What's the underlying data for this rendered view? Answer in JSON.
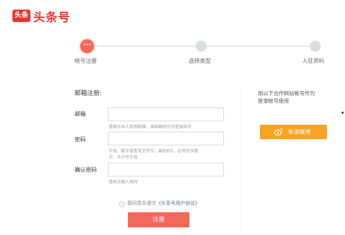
{
  "header": {
    "logo_mark": "头条",
    "logo_text": "头条号"
  },
  "steps": [
    {
      "label": "帐号注册",
      "state": "active",
      "icon": "ellipsis-icon",
      "glyph": "···"
    },
    {
      "label": "选择类型",
      "state": "pending"
    },
    {
      "label": "入驻资料",
      "state": "pending"
    }
  ],
  "form": {
    "title": "邮箱注册:",
    "email": {
      "label": "邮箱",
      "value": "",
      "hint": "请填写本人常用邮箱，该邮箱将作为登录帐号"
    },
    "password": {
      "label": "密码",
      "value": "",
      "hint_line1": "字母、数字或者英文符号，最短8位，必须包含数",
      "hint_line2": "字、大小写字母"
    },
    "confirm": {
      "label": "确认密码",
      "value": "",
      "hint": "请再次输入密码"
    },
    "agree": {
      "prefix": "我同意并遵守",
      "link": "《头条号用户协议》",
      "checked": false
    },
    "submit_label": "注册"
  },
  "sidebar": {
    "text_line1": "用以下合作网站帐号作为",
    "text_line2": "登录帐号使用",
    "weibo_label": "新浪微博",
    "weibo_icon": "weibo-icon"
  },
  "colors": {
    "brand": "#e8362f",
    "register_button": "#f2685a",
    "weibo_button": "#f7a422"
  }
}
